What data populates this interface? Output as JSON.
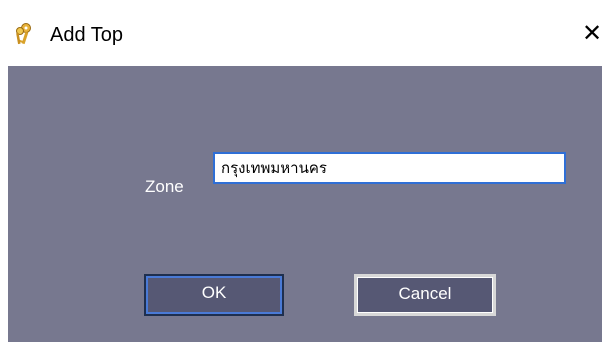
{
  "window": {
    "title": "Add Top",
    "close_glyph": "✕",
    "icon": "keys-icon"
  },
  "form": {
    "zone_label": "Zone",
    "zone_value": "กรุงเทพมหานคร"
  },
  "buttons": {
    "ok_label": "OK",
    "cancel_label": "Cancel"
  },
  "colors": {
    "client_background": "#77788f",
    "button_background": "#565874",
    "focus_border": "#2f6fd6"
  }
}
